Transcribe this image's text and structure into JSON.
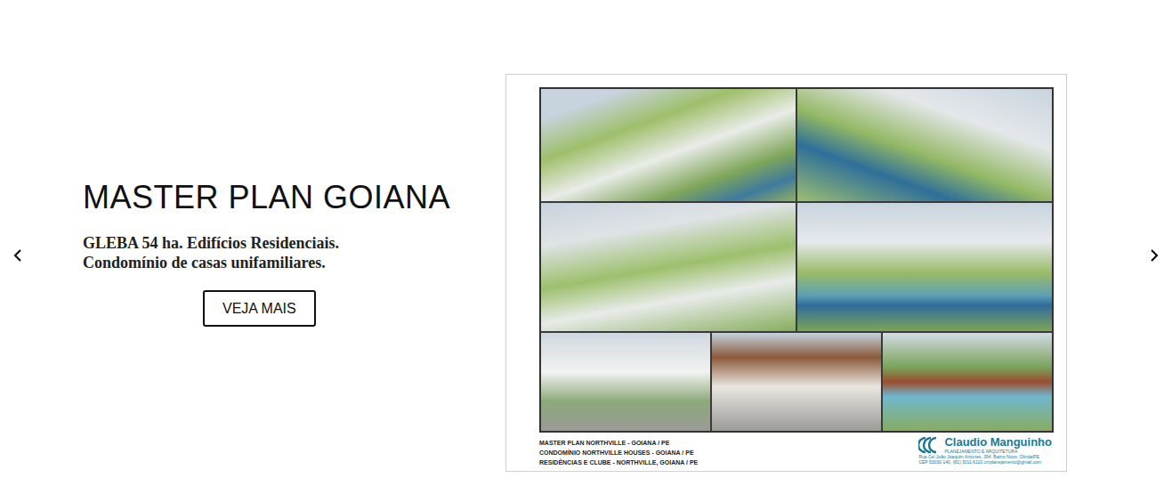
{
  "slide": {
    "title": "MASTER PLAN GOIANA",
    "subtitle": [
      "GLEBA 54 ha. Edifícios Residenciais.",
      "Condomínio de casas unifamiliares."
    ],
    "button": "VEJA MAIS"
  },
  "board": {
    "captions": [
      "MASTER PLAN NORTHVILLE - GOIANA / PE",
      "CONDOMÍNIO NORTHVILLE HOUSES - GOIANA / PE",
      "RESIDÊNCIAS E CLUBE - NORTHVILLE, GOIANA / PE"
    ],
    "logo": {
      "name": "Claudio Manguinho",
      "tagline": "PLANEJAMENTO E ARQUITETURA",
      "address": [
        "Rua Cel João Joaquim Antunes, 394, Bairro Novo, Olinda/PE",
        "CEP 53030-140, (81) 3011-6110 cmplanejamento@gmail.com"
      ]
    }
  }
}
